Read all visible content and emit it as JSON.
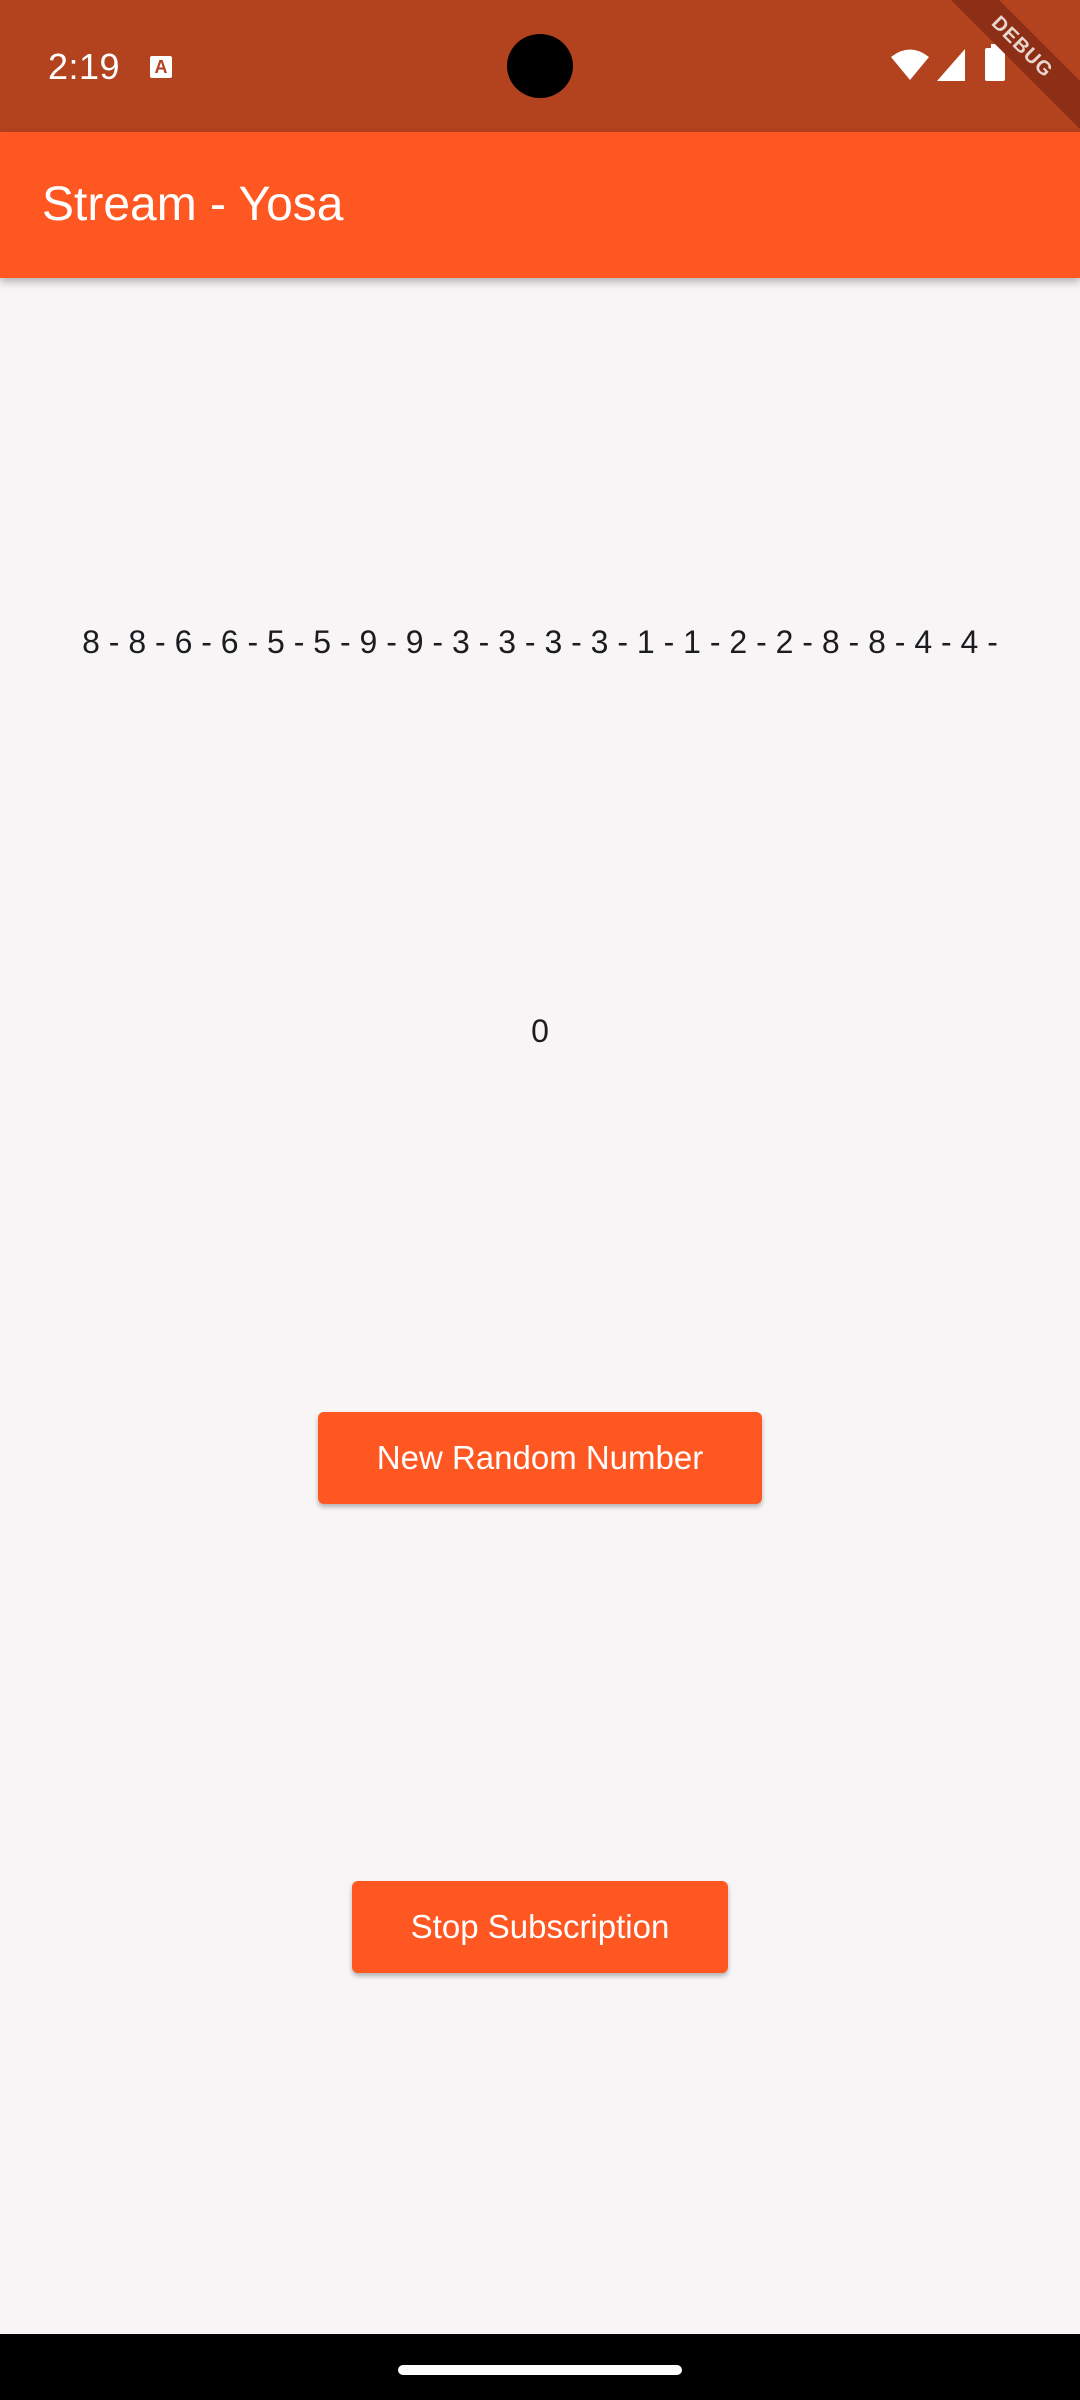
{
  "status_bar": {
    "time": "2:19",
    "notification_icon": "a-icon",
    "notification_letter": "A",
    "icons": [
      "wifi-icon",
      "signal-icon",
      "battery-icon"
    ],
    "debug_banner": "DEBUG"
  },
  "app_bar": {
    "title": "Stream - Yosa"
  },
  "main": {
    "sequence": "8 - 8 - 6 - 6 - 5 - 5 - 9 - 9 - 3 - 3 - 3 - 3 - 1 - 1 - 2 - 2 - 8 - 8 - 4 - 4 -",
    "current_value": "0",
    "new_random_button": "New Random Number",
    "stop_button": "Stop Subscription"
  },
  "colors": {
    "primary": "#ff5722",
    "status_bar": "#b3421f",
    "background": "#f7f5f5"
  }
}
